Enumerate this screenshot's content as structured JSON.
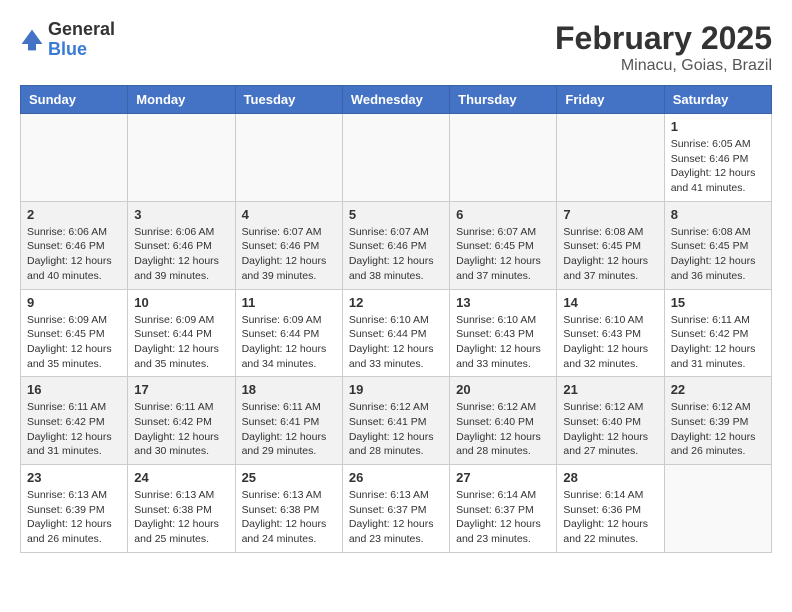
{
  "header": {
    "logo_line1": "General",
    "logo_line2": "Blue",
    "month_year": "February 2025",
    "location": "Minacu, Goias, Brazil"
  },
  "days_of_week": [
    "Sunday",
    "Monday",
    "Tuesday",
    "Wednesday",
    "Thursday",
    "Friday",
    "Saturday"
  ],
  "weeks": [
    [
      {
        "day": "",
        "info": ""
      },
      {
        "day": "",
        "info": ""
      },
      {
        "day": "",
        "info": ""
      },
      {
        "day": "",
        "info": ""
      },
      {
        "day": "",
        "info": ""
      },
      {
        "day": "",
        "info": ""
      },
      {
        "day": "1",
        "info": "Sunrise: 6:05 AM\nSunset: 6:46 PM\nDaylight: 12 hours\nand 41 minutes."
      }
    ],
    [
      {
        "day": "2",
        "info": "Sunrise: 6:06 AM\nSunset: 6:46 PM\nDaylight: 12 hours\nand 40 minutes."
      },
      {
        "day": "3",
        "info": "Sunrise: 6:06 AM\nSunset: 6:46 PM\nDaylight: 12 hours\nand 39 minutes."
      },
      {
        "day": "4",
        "info": "Sunrise: 6:07 AM\nSunset: 6:46 PM\nDaylight: 12 hours\nand 39 minutes."
      },
      {
        "day": "5",
        "info": "Sunrise: 6:07 AM\nSunset: 6:46 PM\nDaylight: 12 hours\nand 38 minutes."
      },
      {
        "day": "6",
        "info": "Sunrise: 6:07 AM\nSunset: 6:45 PM\nDaylight: 12 hours\nand 37 minutes."
      },
      {
        "day": "7",
        "info": "Sunrise: 6:08 AM\nSunset: 6:45 PM\nDaylight: 12 hours\nand 37 minutes."
      },
      {
        "day": "8",
        "info": "Sunrise: 6:08 AM\nSunset: 6:45 PM\nDaylight: 12 hours\nand 36 minutes."
      }
    ],
    [
      {
        "day": "9",
        "info": "Sunrise: 6:09 AM\nSunset: 6:45 PM\nDaylight: 12 hours\nand 35 minutes."
      },
      {
        "day": "10",
        "info": "Sunrise: 6:09 AM\nSunset: 6:44 PM\nDaylight: 12 hours\nand 35 minutes."
      },
      {
        "day": "11",
        "info": "Sunrise: 6:09 AM\nSunset: 6:44 PM\nDaylight: 12 hours\nand 34 minutes."
      },
      {
        "day": "12",
        "info": "Sunrise: 6:10 AM\nSunset: 6:44 PM\nDaylight: 12 hours\nand 33 minutes."
      },
      {
        "day": "13",
        "info": "Sunrise: 6:10 AM\nSunset: 6:43 PM\nDaylight: 12 hours\nand 33 minutes."
      },
      {
        "day": "14",
        "info": "Sunrise: 6:10 AM\nSunset: 6:43 PM\nDaylight: 12 hours\nand 32 minutes."
      },
      {
        "day": "15",
        "info": "Sunrise: 6:11 AM\nSunset: 6:42 PM\nDaylight: 12 hours\nand 31 minutes."
      }
    ],
    [
      {
        "day": "16",
        "info": "Sunrise: 6:11 AM\nSunset: 6:42 PM\nDaylight: 12 hours\nand 31 minutes."
      },
      {
        "day": "17",
        "info": "Sunrise: 6:11 AM\nSunset: 6:42 PM\nDaylight: 12 hours\nand 30 minutes."
      },
      {
        "day": "18",
        "info": "Sunrise: 6:11 AM\nSunset: 6:41 PM\nDaylight: 12 hours\nand 29 minutes."
      },
      {
        "day": "19",
        "info": "Sunrise: 6:12 AM\nSunset: 6:41 PM\nDaylight: 12 hours\nand 28 minutes."
      },
      {
        "day": "20",
        "info": "Sunrise: 6:12 AM\nSunset: 6:40 PM\nDaylight: 12 hours\nand 28 minutes."
      },
      {
        "day": "21",
        "info": "Sunrise: 6:12 AM\nSunset: 6:40 PM\nDaylight: 12 hours\nand 27 minutes."
      },
      {
        "day": "22",
        "info": "Sunrise: 6:12 AM\nSunset: 6:39 PM\nDaylight: 12 hours\nand 26 minutes."
      }
    ],
    [
      {
        "day": "23",
        "info": "Sunrise: 6:13 AM\nSunset: 6:39 PM\nDaylight: 12 hours\nand 26 minutes."
      },
      {
        "day": "24",
        "info": "Sunrise: 6:13 AM\nSunset: 6:38 PM\nDaylight: 12 hours\nand 25 minutes."
      },
      {
        "day": "25",
        "info": "Sunrise: 6:13 AM\nSunset: 6:38 PM\nDaylight: 12 hours\nand 24 minutes."
      },
      {
        "day": "26",
        "info": "Sunrise: 6:13 AM\nSunset: 6:37 PM\nDaylight: 12 hours\nand 23 minutes."
      },
      {
        "day": "27",
        "info": "Sunrise: 6:14 AM\nSunset: 6:37 PM\nDaylight: 12 hours\nand 23 minutes."
      },
      {
        "day": "28",
        "info": "Sunrise: 6:14 AM\nSunset: 6:36 PM\nDaylight: 12 hours\nand 22 minutes."
      },
      {
        "day": "",
        "info": ""
      }
    ]
  ]
}
